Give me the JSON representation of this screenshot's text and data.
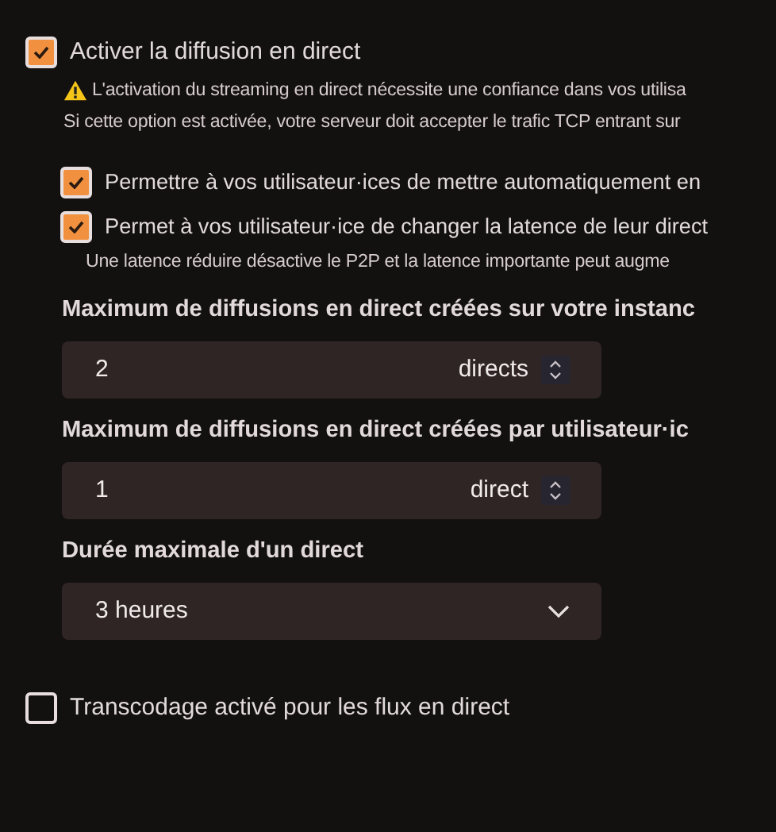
{
  "items": [
    {
      "kind": "checkbox",
      "label": "Activer la diffusion en direct",
      "checked": true,
      "nested": false,
      "hints": [
        {
          "warning": true,
          "text": "L'activation du streaming en direct nécessite une confiance dans vos utilisa"
        },
        {
          "warning": false,
          "text": "Si cette option est activée, votre serveur doit accepter le trafic TCP entrant sur"
        }
      ]
    },
    {
      "kind": "checkbox",
      "label": "Permettre à vos utilisateur·ices de mettre automatiquement en",
      "checked": true,
      "nested": true
    },
    {
      "kind": "checkbox",
      "label": "Permet à vos utilisateur·ice de changer la latence de leur direct",
      "checked": true,
      "nested": true,
      "hints": [
        {
          "warning": false,
          "text": "Une latence réduire désactive le P2P et la latence importante peut augme"
        }
      ]
    },
    {
      "kind": "number",
      "label": "Maximum de diffusions en direct créées sur votre instanc",
      "value": "2",
      "unit": "directs"
    },
    {
      "kind": "number",
      "label": "Maximum de diffusions en direct créées par utilisateur·ic",
      "value": "1",
      "unit": "direct"
    },
    {
      "kind": "select",
      "label": "Durée maximale d'un direct",
      "value": "3 heures"
    },
    {
      "kind": "checkbox",
      "label": "Transcodage activé pour les flux en direct",
      "checked": false,
      "nested": false
    }
  ]
}
